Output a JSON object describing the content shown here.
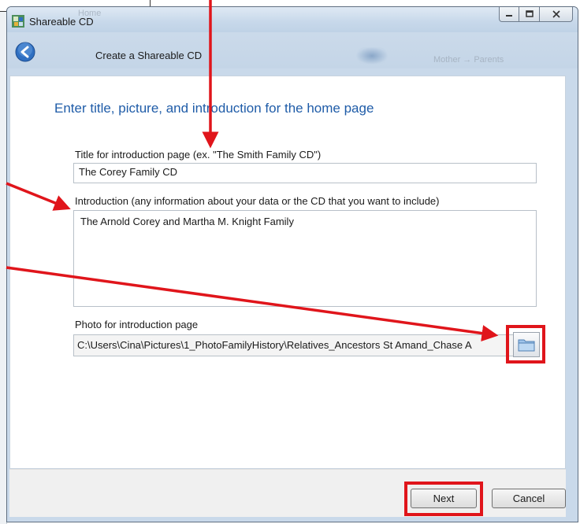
{
  "window": {
    "title": "Shareable CD",
    "ghost_title_a": "Shareable CD",
    "ghost_title_b": "Home",
    "ghost_nav_right": "Mother → Parents"
  },
  "nav": {
    "title": "Create a Shareable CD"
  },
  "page": {
    "heading": "Enter title, picture, and introduction for the home page"
  },
  "form": {
    "title_label": "Title for introduction page (ex. \"The Smith Family CD\")",
    "title_value": "The Corey Family CD",
    "intro_label": "Introduction (any information about your data or the CD that you want to include)",
    "intro_value": "The Arnold Corey and Martha M. Knight Family",
    "photo_label": "Photo for introduction page",
    "photo_path": "C:\\Users\\Cina\\Pictures\\1_PhotoFamilyHistory\\Relatives_Ancestors St Amand_Chase A"
  },
  "buttons": {
    "next": "Next",
    "cancel": "Cancel"
  },
  "colors": {
    "annotation_red": "#e0151b",
    "heading_blue": "#1f5ca8",
    "back_button_blue": "#2f6fc1"
  },
  "icons": {
    "app": "shareable-cd-app-icon",
    "back": "back-arrow-icon",
    "browse": "folder-icon"
  }
}
